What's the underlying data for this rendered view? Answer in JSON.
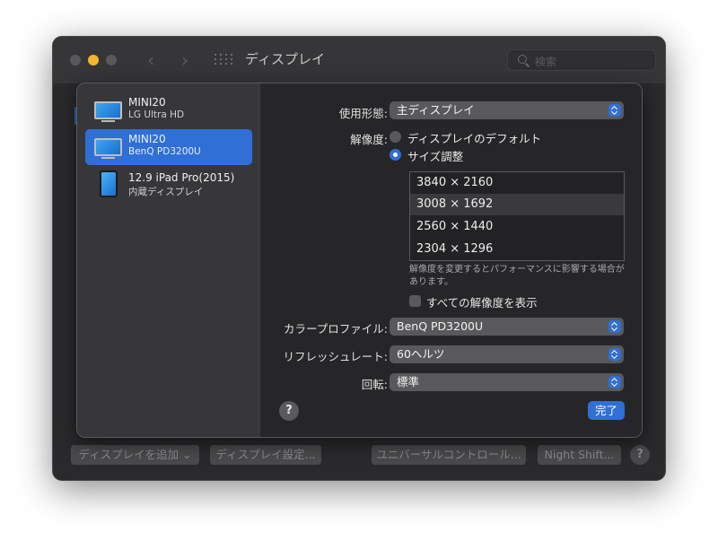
{
  "window": {
    "title": "ディスプレイ",
    "search_placeholder": "検索",
    "bottom_buttons": {
      "add_display": "ディスプレイを追加 ⌄",
      "display_settings": "ディスプレイ設定...",
      "universal_control": "ユニバーサルコントロール...",
      "night_shift": "Night Shift...",
      "help": "?"
    }
  },
  "sidebar": {
    "devices": [
      {
        "name": "MINI20",
        "model": "LG Ultra HD",
        "selected": false,
        "icon": "monitor-icon"
      },
      {
        "name": "MINI20",
        "model": "BenQ PD3200U",
        "selected": true,
        "icon": "monitor-icon"
      },
      {
        "name": "12.9 iPad Pro(2015)",
        "model": "内蔵ディスプレイ",
        "selected": false,
        "icon": "ipad-icon"
      }
    ]
  },
  "settings": {
    "use_as_label": "使用形態:",
    "use_as_value": "主ディスプレイ",
    "resolution_label": "解像度:",
    "resolution_default": "ディスプレイのデフォルト",
    "resolution_scaled": "サイズ調整",
    "resolution_options": [
      "3840 × 2160",
      "3008 × 1692",
      "2560 × 1440",
      "2304 × 1296"
    ],
    "selected_resolution": "3008 × 1692",
    "note": "解像度を変更するとパフォーマンスに影響する場合があります。",
    "show_all_label": "すべての解像度を表示",
    "color_profile_label": "カラープロファイル:",
    "color_profile_value": "BenQ PD3200U",
    "refresh_rate_label": "リフレッシュレート:",
    "refresh_rate_value": "60ヘルツ",
    "rotation_label": "回転:",
    "rotation_value": "標準",
    "help": "?",
    "done": "完了"
  },
  "colors": {
    "accent": "#2f6fd6",
    "traffic_yellow": "#f5b62c",
    "window_bg": "#2a2a2c",
    "sidebar_bg": "#37373a"
  }
}
